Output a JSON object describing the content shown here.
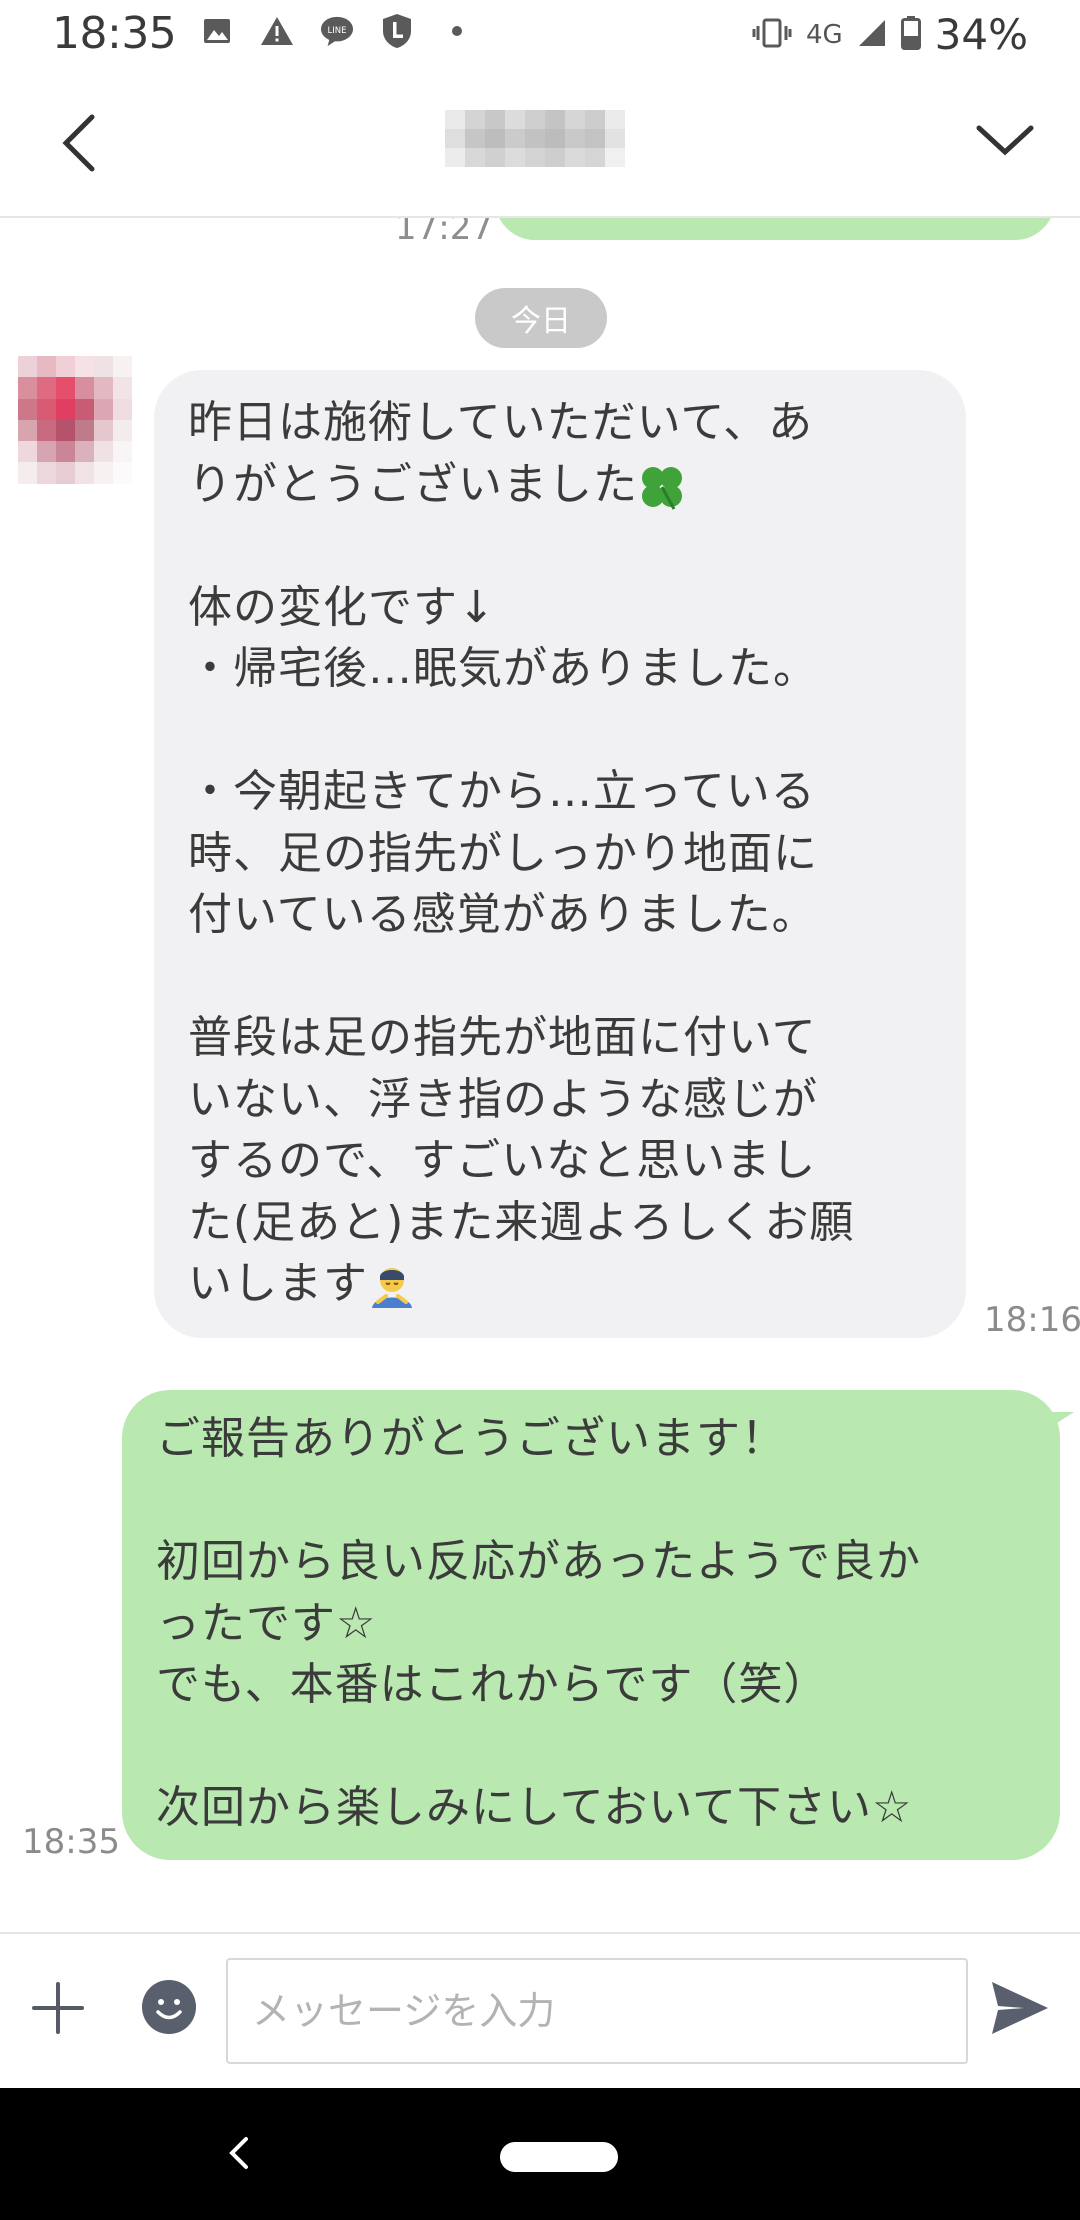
{
  "status_bar": {
    "time": "18:35",
    "network": "4G",
    "battery": "34%",
    "notification_icons": [
      "image-icon",
      "warning-icon",
      "line-icon",
      "l-shield-icon",
      "dot-icon"
    ]
  },
  "header": {
    "title": "",
    "back_icon": "chevron-left-icon",
    "menu_icon": "chevron-down-icon"
  },
  "chat": {
    "previous_time": "17:27",
    "date_label": "今日",
    "messages": [
      {
        "direction": "incoming",
        "text": "昨日は施術していただいて、あ\nりがとうございました",
        "text_rest": "\n\n体の変化です↓\n・帰宅後…眠気がありました。\n\n・今朝起きてから…立っている\n時、足の指先がしっかり地面に\n付いている感覚がありました。\n\n普段は足の指先が地面に付いて\nいない、浮き指のような感じが\nするので、すごいなと思いまし\nた(足あと)また来週よろしくお願\nいします",
        "time": "18:16"
      },
      {
        "direction": "outgoing",
        "text": "ご報告ありがとうございます！\n\n初回から良い反応があったようで良か\nったです☆\nでも、本番はこれからです（笑）\n\n次回から楽しみにしておいて下さい☆",
        "time": "18:35"
      }
    ]
  },
  "input": {
    "placeholder": "メッセージを入力",
    "value": ""
  },
  "colors": {
    "outgoing_bubble": "#b9e8b1",
    "incoming_bubble": "#f1f1f3",
    "date_pill": "#c9c9c9"
  }
}
